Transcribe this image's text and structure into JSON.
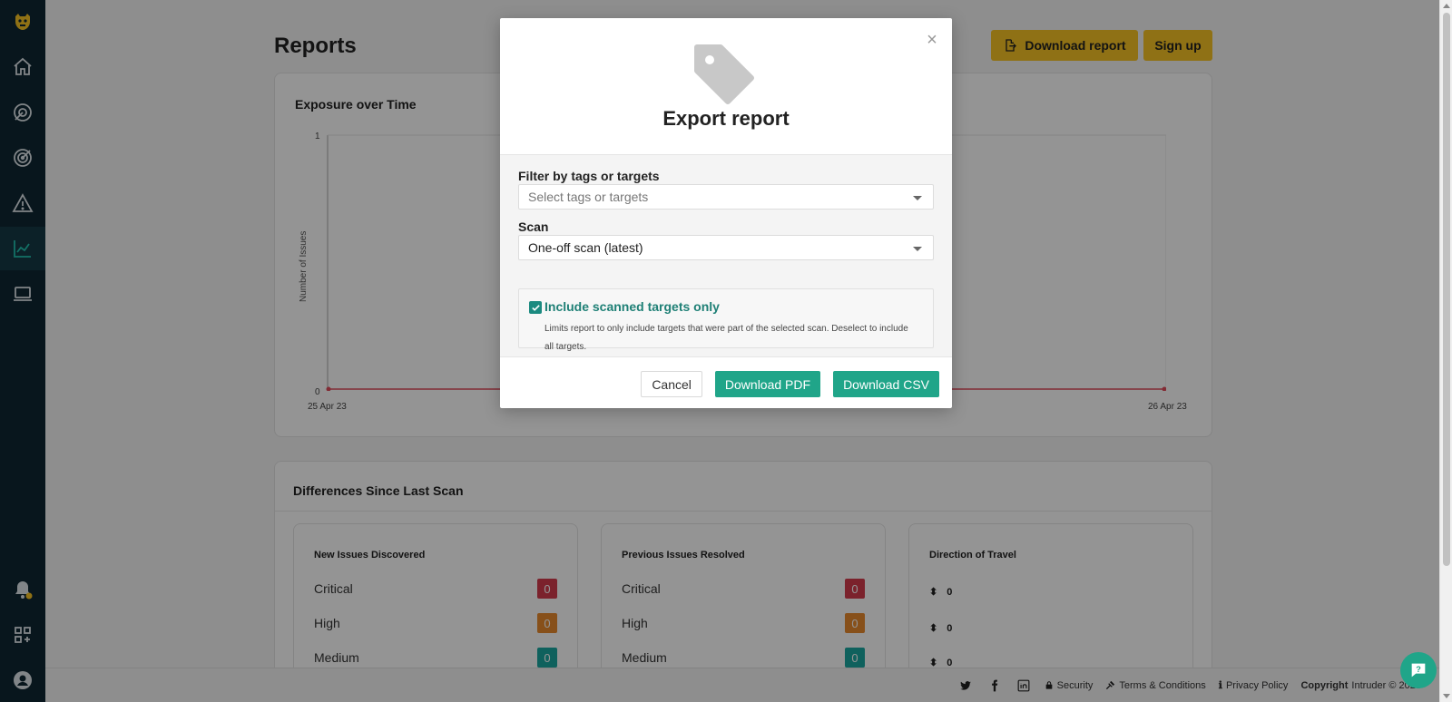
{
  "page": {
    "title": "Reports",
    "download_report_label": "Download report",
    "signup_label": "Sign up"
  },
  "exposure": {
    "title": "Exposure over Time",
    "ylabel": "Number of Issues",
    "y_ticks": [
      "1",
      "0"
    ],
    "x_ticks": [
      "25 Apr 23",
      "26 Apr 23"
    ]
  },
  "differences": {
    "title": "Differences Since Last Scan",
    "new_issues": {
      "title": "New Issues Discovered",
      "rows": [
        {
          "label": "Critical",
          "value": "0"
        },
        {
          "label": "High",
          "value": "0"
        },
        {
          "label": "Medium",
          "value": "0"
        }
      ]
    },
    "resolved": {
      "title": "Previous Issues Resolved",
      "rows": [
        {
          "label": "Critical",
          "value": "0"
        },
        {
          "label": "High",
          "value": "0"
        },
        {
          "label": "Medium",
          "value": "0"
        }
      ]
    },
    "direction": {
      "title": "Direction of Travel",
      "values": [
        "0",
        "0",
        "0"
      ]
    }
  },
  "modal": {
    "title": "Export report",
    "filter_label": "Filter by tags or targets",
    "filter_placeholder": "Select tags or targets",
    "scan_label": "Scan",
    "scan_value": "One-off scan (latest)",
    "checkbox_label": "Include scanned targets only",
    "checkbox_checked": true,
    "checkbox_desc": "Limits report to only include targets that were part of the selected scan. Deselect to include all targets.",
    "cancel_label": "Cancel",
    "pdf_label": "Download PDF",
    "csv_label": "Download CSV"
  },
  "footer": {
    "security": "Security",
    "terms": "Terms & Conditions",
    "privacy": "Privacy Policy",
    "copyright_bold": "Copyright",
    "copyright_rest": "Intruder © 2023"
  },
  "colors": {
    "sidebar": "#0f2733",
    "accent": "#20a589",
    "yellow": "#f7c325",
    "critical": "#d43c4d",
    "high": "#e88b2d",
    "medium": "#1ba8a0"
  },
  "icons": {
    "sidebar": [
      "logo-icon",
      "home-icon",
      "radar-icon",
      "target-icon",
      "warning-icon",
      "chart-icon",
      "laptop-icon",
      "bell-icon",
      "apps-icon",
      "user-icon"
    ]
  }
}
